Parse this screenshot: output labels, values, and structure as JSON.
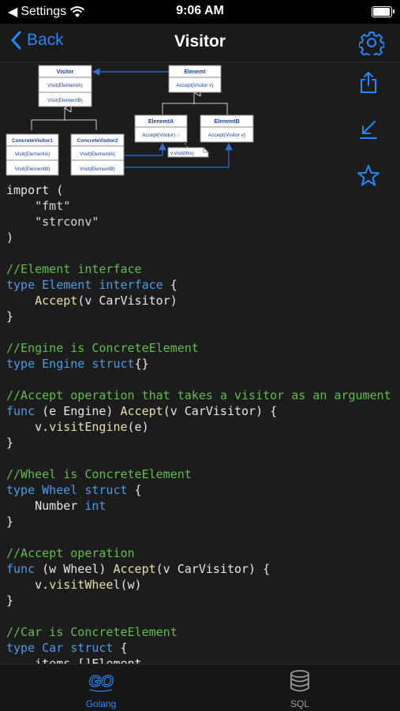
{
  "status": {
    "carrier": "Settings",
    "time": "9:06 AM"
  },
  "nav": {
    "back_label": "Back",
    "title": "Visitor"
  },
  "diagram": {
    "visitor": {
      "title": "Visitor",
      "ops": [
        "Visit(ElementA)",
        "Visit(ElementB)"
      ]
    },
    "element": {
      "title": "Elenemt",
      "ops": [
        "Accept(Visitor v)"
      ]
    },
    "cv1": {
      "title": "ConcreteVisitor1",
      "ops": [
        "Visit(ElementA)",
        "Visit(ElementB)"
      ]
    },
    "cv2": {
      "title": "ConcreteVisitor2",
      "ops": [
        "Visit(ElementA)",
        "Visit(ElementB)"
      ]
    },
    "ea": {
      "title": "ElenemtA",
      "ops": [
        "Accept(Visitor) ○"
      ]
    },
    "eb": {
      "title": "ElenemtB",
      "ops": [
        "Accept(Visitor v)"
      ]
    },
    "note": "v.Visit(this)"
  },
  "code_lines": [
    [
      [
        "import (",
        ""
      ]
    ],
    [
      [
        "    ",
        ""
      ],
      [
        "\"fmt\"",
        "str"
      ]
    ],
    [
      [
        "    ",
        ""
      ],
      [
        "\"strconv\"",
        "str"
      ]
    ],
    [
      [
        ")",
        ""
      ]
    ],
    [
      [
        "",
        ""
      ]
    ],
    [
      [
        "//Element interface",
        "cm"
      ]
    ],
    [
      [
        "type ",
        "kw"
      ],
      [
        "Element ",
        "ty"
      ],
      [
        "interface",
        "kw"
      ],
      [
        " {",
        ""
      ]
    ],
    [
      [
        "    ",
        ""
      ],
      [
        "Accept",
        "fn"
      ],
      [
        "(v CarVisitor)",
        ""
      ]
    ],
    [
      [
        "}",
        ""
      ]
    ],
    [
      [
        "",
        ""
      ]
    ],
    [
      [
        "//Engine is ConcreteElement",
        "cm"
      ]
    ],
    [
      [
        "type ",
        "kw"
      ],
      [
        "Engine ",
        "ty"
      ],
      [
        "struct",
        "kw"
      ],
      [
        "{}",
        ""
      ]
    ],
    [
      [
        "",
        ""
      ]
    ],
    [
      [
        "//Accept operation that takes a visitor as an argument",
        "cm"
      ]
    ],
    [
      [
        "func",
        "kw"
      ],
      [
        " (e Engine) ",
        ""
      ],
      [
        "Accept",
        "fn"
      ],
      [
        "(v CarVisitor) {",
        ""
      ]
    ],
    [
      [
        "    v.",
        ""
      ],
      [
        "visitEngine",
        "fn"
      ],
      [
        "(e)",
        ""
      ]
    ],
    [
      [
        "}",
        ""
      ]
    ],
    [
      [
        "",
        ""
      ]
    ],
    [
      [
        "//Wheel is ConcreteElement",
        "cm"
      ]
    ],
    [
      [
        "type ",
        "kw"
      ],
      [
        "Wheel ",
        "ty"
      ],
      [
        "struct",
        "kw"
      ],
      [
        " {",
        ""
      ]
    ],
    [
      [
        "    Number ",
        ""
      ],
      [
        "int",
        "kw"
      ]
    ],
    [
      [
        "}",
        ""
      ]
    ],
    [
      [
        "",
        ""
      ]
    ],
    [
      [
        "//Accept operation",
        "cm"
      ]
    ],
    [
      [
        "func",
        "kw"
      ],
      [
        " (w Wheel) ",
        ""
      ],
      [
        "Accept",
        "fn"
      ],
      [
        "(v CarVisitor) {",
        ""
      ]
    ],
    [
      [
        "    v.",
        ""
      ],
      [
        "visitWheel",
        "fn"
      ],
      [
        "(w)",
        ""
      ]
    ],
    [
      [
        "}",
        ""
      ]
    ],
    [
      [
        "",
        ""
      ]
    ],
    [
      [
        "//Car is ConcreteElement",
        "cm"
      ]
    ],
    [
      [
        "type ",
        "kw"
      ],
      [
        "Car ",
        "ty"
      ],
      [
        "struct",
        "kw"
      ],
      [
        " {",
        ""
      ]
    ],
    [
      [
        "    items []Element",
        ""
      ]
    ]
  ],
  "tabs": [
    {
      "label": "Golang",
      "icon": "go-logo-icon",
      "active": true
    },
    {
      "label": "SQL",
      "icon": "database-icon",
      "active": false
    }
  ],
  "colors": {
    "accent": "#1e8bff",
    "keyword": "#4c9be8",
    "comment": "#5fbf4c",
    "function": "#e5e1a8"
  }
}
